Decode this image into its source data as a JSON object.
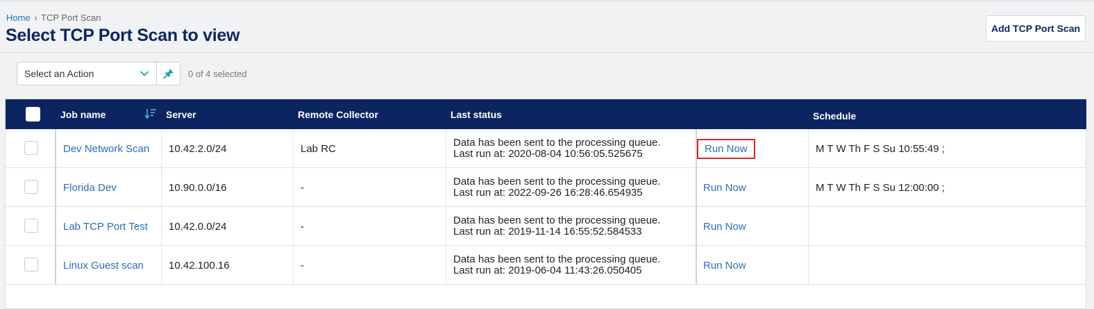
{
  "breadcrumb": {
    "home": "Home",
    "separator": "›",
    "current": "TCP Port Scan"
  },
  "page": {
    "title": "Select TCP Port Scan to view",
    "add_button": "Add TCP Port Scan"
  },
  "action_bar": {
    "select_label": "Select an Action",
    "selected_count": "0 of 4 selected"
  },
  "colors": {
    "header_bg": "#0c2461",
    "title": "#0e2661",
    "link": "#2a6ebb",
    "highlight": "#d9262a"
  },
  "table": {
    "columns": {
      "job_name": "Job name",
      "server": "Server",
      "remote_collector": "Remote Collector",
      "last_status": "Last status",
      "schedule": "Schedule"
    },
    "rows": [
      {
        "job_name": "Dev Network Scan",
        "server": "10.42.2.0/24",
        "remote_collector": "Lab RC",
        "status_line1": "Data has been sent to the processing queue.",
        "status_line2": "Last run at: 2020-08-04 10:56:05.525675",
        "action": "Run Now",
        "schedule": "M T W Th F S Su 10:55:49 ;",
        "highlighted": true
      },
      {
        "job_name": "Florida Dev",
        "server": "10.90.0.0/16",
        "remote_collector": "-",
        "status_line1": "Data has been sent to the processing queue.",
        "status_line2": "Last run at: 2022-09-26 16:28:46.654935",
        "action": "Run Now",
        "schedule": "M T W Th F S Su 12:00:00 ;",
        "highlighted": false
      },
      {
        "job_name": "Lab TCP Port Test",
        "server": "10.42.0.0/24",
        "remote_collector": "-",
        "status_line1": "Data has been sent to the processing queue.",
        "status_line2": "Last run at: 2019-11-14 16:55:52.584533",
        "action": "Run Now",
        "schedule": "",
        "highlighted": false
      },
      {
        "job_name": "Linux Guest scan",
        "server": "10.42.100.16",
        "remote_collector": "-",
        "status_line1": "Data has been sent to the processing queue.",
        "status_line2": "Last run at: 2019-06-04 11:43:26.050405",
        "action": "Run Now",
        "schedule": "",
        "highlighted": false
      }
    ]
  }
}
